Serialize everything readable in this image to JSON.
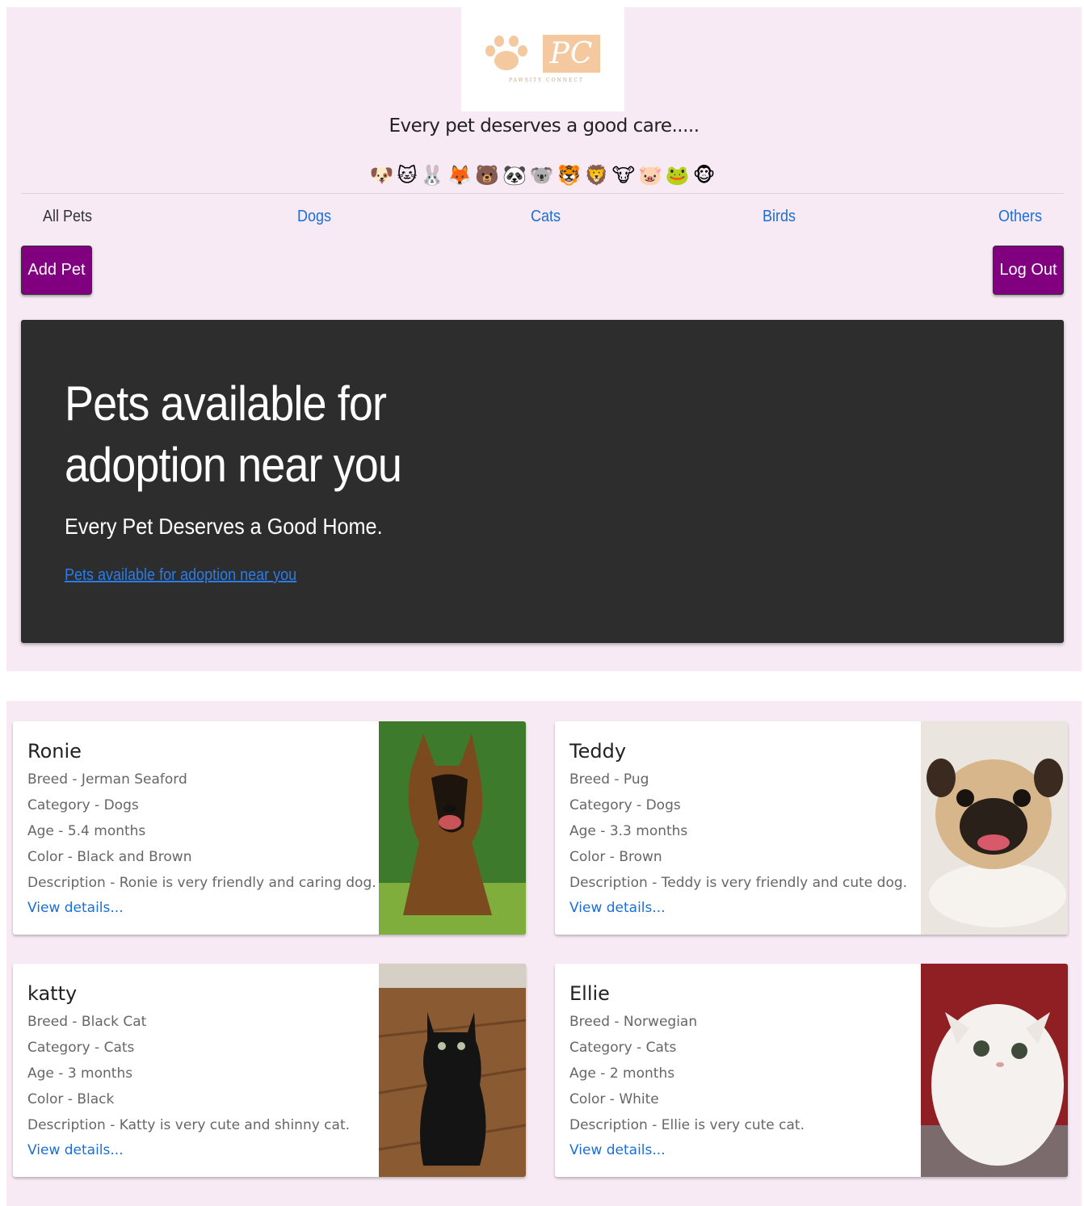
{
  "brand": {
    "logo_text": "PC",
    "logo_subtext": "PAWSITY CONNECT",
    "tagline": "Every pet deserves a good care....."
  },
  "animal_emojis": "🐶🐱🐰🦊🐻🐼🐨🐯🦁🐮🐷🐸🐵",
  "nav": {
    "all": "All Pets",
    "dogs": "Dogs",
    "cats": "Cats",
    "birds": "Birds",
    "others": "Others"
  },
  "actions": {
    "add": "Add Pet",
    "logout": "Log Out"
  },
  "hero": {
    "title": "Pets available for adoption near you",
    "subtitle": "Every Pet Deserves a Good Home.",
    "link": "Pets available for adoption near you"
  },
  "pets": [
    {
      "name": "Ronie",
      "breed": "Breed - Jerman Seaford",
      "category": "Category - Dogs",
      "age": "Age - 5.4 months",
      "color": "Color - Black and Brown",
      "description": "Description - Ronie is very friendly and caring dog.",
      "link": "View details..."
    },
    {
      "name": "Teddy",
      "breed": "Breed - Pug",
      "category": "Category - Dogs",
      "age": "Age - 3.3 months",
      "color": "Color - Brown",
      "description": "Description - Teddy is very friendly and cute dog.",
      "link": "View details..."
    },
    {
      "name": "katty",
      "breed": "Breed - Black Cat",
      "category": "Category - Cats",
      "age": "Age - 3 months",
      "color": "Color - Black",
      "description": "Description - Katty is very cute and shinny cat.",
      "link": "View details..."
    },
    {
      "name": "Ellie",
      "breed": "Breed - Norwegian",
      "category": "Category - Cats",
      "age": "Age - 2 months",
      "color": "Color - White",
      "description": "Description - Ellie is very cute cat.",
      "link": "View details..."
    }
  ],
  "colors": {
    "background": "#f7eaf4",
    "button": "#800080",
    "hero": "#2d2d2d",
    "link": "#1a6fd4"
  }
}
